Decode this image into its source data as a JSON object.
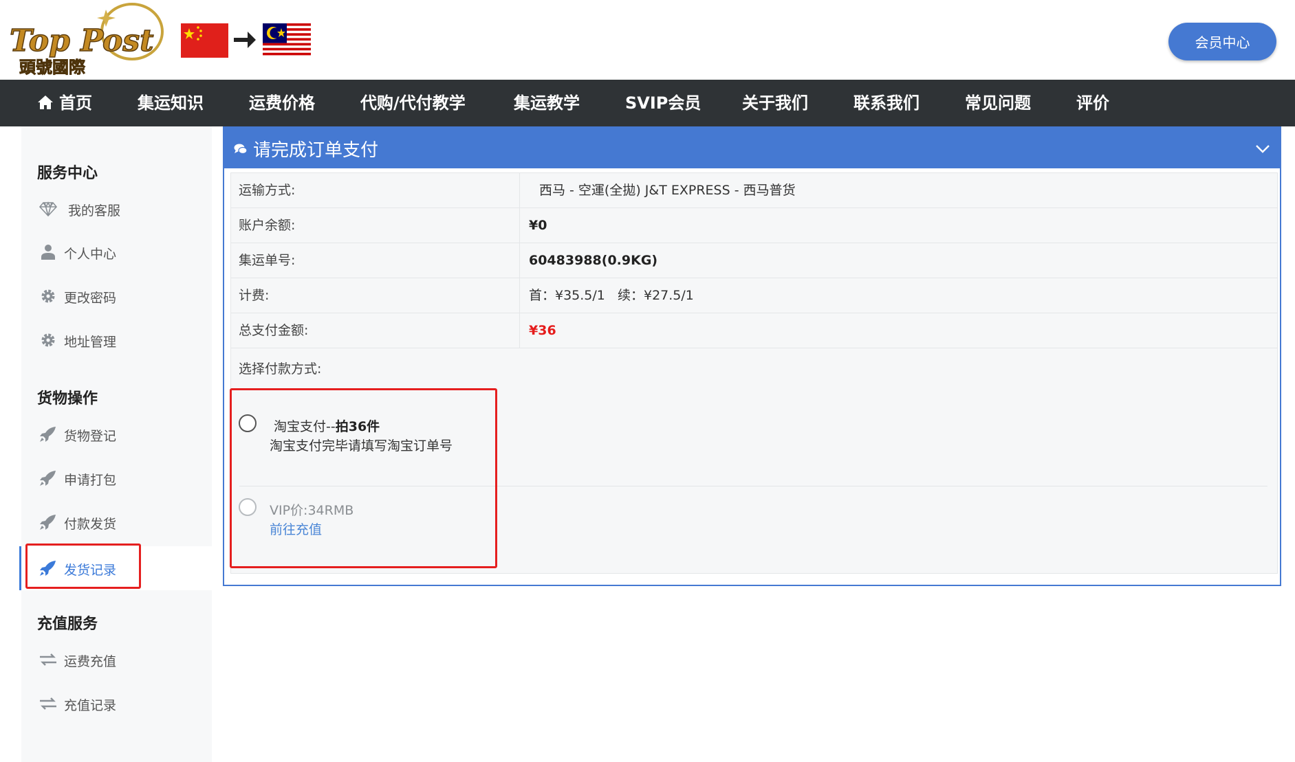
{
  "header": {
    "logo_text": "Top Post",
    "logo_sub": "頭號國際",
    "member_center": "会员中心",
    "flags": [
      "cn-flag",
      "my-flag"
    ]
  },
  "nav": {
    "items": [
      {
        "label": "首页",
        "icon": "home-icon"
      },
      {
        "label": "集运知识"
      },
      {
        "label": "运费价格"
      },
      {
        "label": "代购/代付教学"
      },
      {
        "label": "集运教学"
      },
      {
        "label": "SVIP会员"
      },
      {
        "label": "关于我们"
      },
      {
        "label": "联系我们"
      },
      {
        "label": "常见问题"
      },
      {
        "label": "评价"
      }
    ]
  },
  "sidebar": {
    "sections": [
      {
        "title": "服务中心",
        "items": [
          {
            "label": "我的客服",
            "icon": "diamond-icon"
          },
          {
            "label": "个人中心",
            "icon": "user-icon"
          },
          {
            "label": "更改密码",
            "icon": "gear-icon"
          },
          {
            "label": "地址管理",
            "icon": "gear-icon"
          }
        ]
      },
      {
        "title": "货物操作",
        "items": [
          {
            "label": "货物登记",
            "icon": "rocket-icon"
          },
          {
            "label": "申请打包",
            "icon": "rocket-icon"
          },
          {
            "label": "付款发货",
            "icon": "rocket-icon"
          },
          {
            "label": "发货记录",
            "icon": "rocket-icon",
            "active": true
          }
        ]
      },
      {
        "title": "充值服务",
        "items": [
          {
            "label": "运费充值",
            "icon": "exchange-icon"
          },
          {
            "label": "充值记录",
            "icon": "exchange-icon"
          }
        ]
      }
    ]
  },
  "panel": {
    "title": "请完成订单支付",
    "rows": [
      {
        "label": "运输方式:",
        "value": "西马 - 空運(全拋) J&T EXPRESS - 西马普货"
      },
      {
        "label": "账户余额:",
        "value": "¥0"
      },
      {
        "label": "集运单号:",
        "value": "60483988(0.9KG)"
      },
      {
        "label": "计费:",
        "value": "首：¥35.5/1   续：¥27.5/1"
      },
      {
        "label": "总支付金额:",
        "value": "¥36"
      }
    ],
    "payment_label": "选择付款方式:",
    "options": [
      {
        "title": "淘宝支付--",
        "title_bold": "拍36件",
        "sub": "淘宝支付完毕请填写淘宝订单号"
      },
      {
        "title": "VIP价:34RMB",
        "link": "前往充值"
      }
    ]
  },
  "colors": {
    "accent": "#4579d2",
    "nav_bg": "#2f3336",
    "highlight": "#e51f1f",
    "amount": "#e51c1c",
    "link": "#4a86d6"
  }
}
